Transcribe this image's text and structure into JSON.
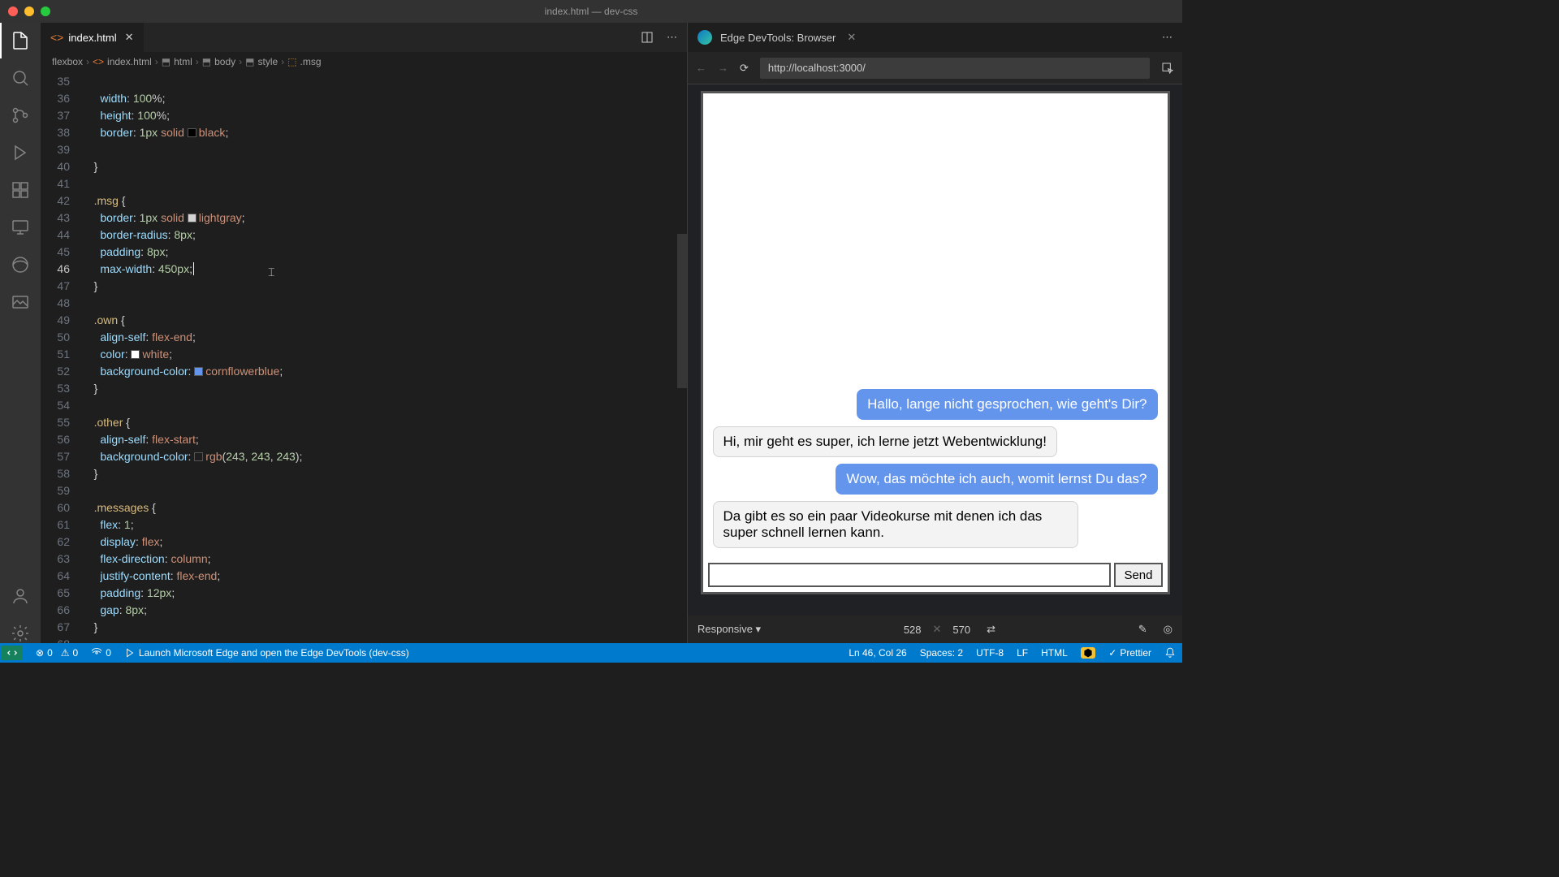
{
  "window_title": "index.html — dev-css",
  "tab": {
    "name": "index.html"
  },
  "tab_actions": {
    "split": "⫞",
    "more": "⋯"
  },
  "crumbs": [
    "flexbox",
    "index.html",
    "html",
    "body",
    "style",
    ".msg"
  ],
  "line_start": 35,
  "cursor": {
    "line": 46,
    "col": 26
  },
  "code_lines": [
    "",
    "      width: 100%;",
    "      height: 100%;",
    "      border: 1px solid ▢black;",
    "",
    "    }",
    "",
    "    .msg {",
    "      border: 1px solid ▢lightgray;",
    "      border-radius: 8px;",
    "      padding: 8px;",
    "      max-width: 450px;|",
    "    }",
    "",
    "    .own {",
    "      align-self: flex-end;",
    "      color: ▢white;",
    "      background-color: ▢cornflowerblue;",
    "    }",
    "",
    "    .other {",
    "      align-self: flex-start;",
    "      background-color: ▢rgb(243, 243, 243);",
    "    }",
    "",
    "    .messages {",
    "      flex: 1;",
    "      display: flex;",
    "      flex-direction: column;",
    "      justify-content: flex-end;",
    "      padding: 12px;",
    "      gap: 8px;",
    "    }",
    ""
  ],
  "devtools": {
    "title": "Edge DevTools: Browser",
    "url": "http://localhost:3000/",
    "responsive_label": "Responsive",
    "width": "528",
    "height": "570"
  },
  "chat": {
    "messages": [
      {
        "class": "own",
        "text": "Hallo, lange nicht gesprochen, wie geht's Dir?"
      },
      {
        "class": "other",
        "text": "Hi, mir geht es super, ich lerne jetzt Webentwicklung!"
      },
      {
        "class": "own",
        "text": "Wow, das möchte ich auch, womit lernst Du das?"
      },
      {
        "class": "other",
        "text": "Da gibt es so ein paar Videokurse mit denen ich das super schnell lernen kann."
      }
    ],
    "send_label": "Send"
  },
  "status": {
    "errors": "0",
    "warnings": "0",
    "port": "0",
    "launch_text": "Launch Microsoft Edge and open the Edge DevTools (dev-css)",
    "ln_col": "Ln 46, Col 26",
    "spaces": "Spaces: 2",
    "encoding": "UTF-8",
    "eol": "LF",
    "lang": "HTML",
    "prettier": "Prettier"
  }
}
